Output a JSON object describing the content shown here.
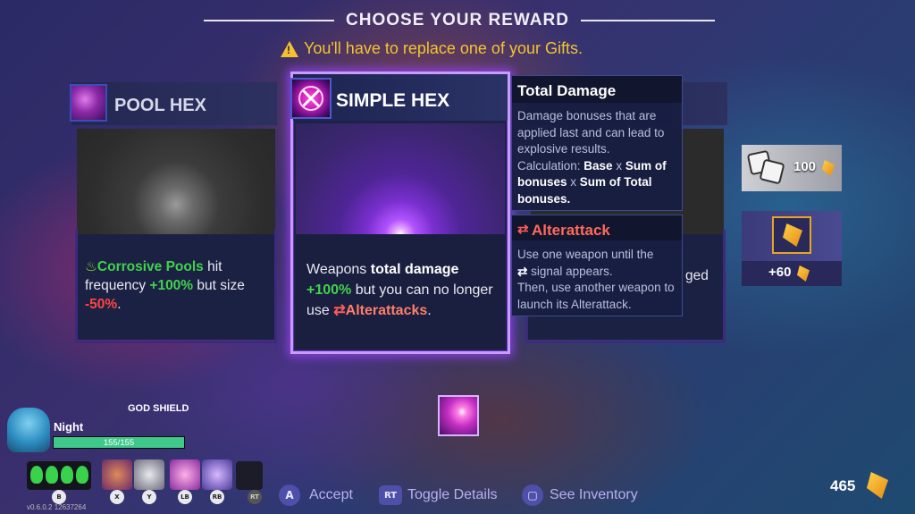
{
  "header": {
    "title": "CHOOSE YOUR REWARD",
    "warning": "You'll have to replace one of your Gifts."
  },
  "cards": {
    "pool_hex": {
      "name": "POOL HEX",
      "desc_term": "Corrosive Pools",
      "desc_a": " hit frequency ",
      "desc_bonus": "+100%",
      "desc_b": " but size ",
      "desc_malus": "-50%",
      "desc_c": "."
    },
    "simple_hex": {
      "name": "SIMPLE HEX",
      "desc_a": "Weapons ",
      "desc_term": "total damage",
      "desc_bonus": "+100%",
      "desc_b": " but you can no longer use ",
      "desc_link": "Alterattacks",
      "desc_c": "."
    },
    "third": {
      "partial_text": "ged"
    }
  },
  "tooltips": {
    "total_damage": {
      "title": "Total Damage",
      "body_a": "Damage bonuses that are applied last and can lead to explosive results.",
      "body_b": "Calculation: ",
      "base": "Base",
      "x1": " x ",
      "sum_bonuses": "Sum of bonuses",
      "x2": " x ",
      "sum_total": "Sum of Total bonuses."
    },
    "alterattack": {
      "title": "Alterattack",
      "body_a": "Use one weapon until the",
      "body_b": "signal appears.",
      "body_c": "Then, use another weapon to launch its Alterattack."
    }
  },
  "rewards": {
    "dice_cost": "100",
    "fang_bonus": "+60"
  },
  "player": {
    "name": "Night",
    "shield_label": "GOD SHIELD",
    "health_text": "155/155",
    "health_fraction": 1.0,
    "version": "v0.6.0.2 12637264",
    "currency": "465"
  },
  "slots": {
    "potion_key": "B",
    "slot_x_key": "X",
    "slot_y_key": "Y",
    "slot_lb_key": "LB",
    "slot_rb_key": "RB",
    "slot_rt_key": "RT"
  },
  "actions": {
    "accept_key": "A",
    "accept_label": "Accept",
    "toggle_key": "RT",
    "toggle_label": "Toggle Details",
    "inventory_label": "See Inventory"
  },
  "colors": {
    "accent_purple": "#8b3fe0",
    "gold": "#f4c330",
    "green": "#41d24c",
    "red": "#ff4545",
    "health": "#3ec98a"
  },
  "icons": [
    "warning-icon",
    "pool-hex-icon",
    "simple-hex-icon",
    "dice-icon",
    "fang-icon",
    "alterattack-icon",
    "hex-gift-icon",
    "portrait-avatar"
  ]
}
